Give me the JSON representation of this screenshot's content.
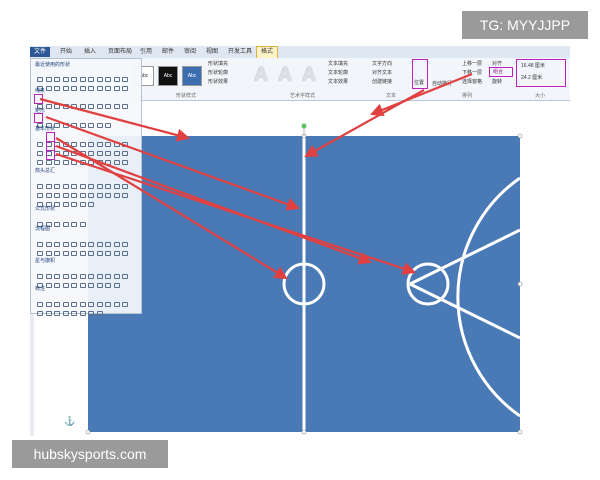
{
  "ribbon": {
    "tabs": [
      {
        "label": "文件"
      },
      {
        "label": "开始"
      },
      {
        "label": "插入"
      },
      {
        "label": "页面布局"
      },
      {
        "label": "引用"
      },
      {
        "label": "邮件"
      },
      {
        "label": "审阅"
      },
      {
        "label": "视图"
      },
      {
        "label": "开发工具"
      },
      {
        "label": "格式"
      }
    ],
    "style_swatches": [
      {
        "label": "Abc"
      },
      {
        "label": "Abc"
      },
      {
        "label": "Abc"
      }
    ],
    "shape_fill": "形状填充",
    "shape_outline": "形状轮廓",
    "shape_effect": "形状效果",
    "group_shape_style": "形状样式",
    "group_wordart": "艺术字样式",
    "text_fill": "文本填充",
    "text_outline": "文本轮廓",
    "text_effect": "文本效果",
    "text_direction": "文字方向",
    "align_text": "对齐文本",
    "create_link": "创建链接",
    "group_text": "文本",
    "position": "位置",
    "auto_wrap": "自动换行",
    "bring_forward": "上移一层",
    "send_backward": "下移一层",
    "selection_pane": "选择窗格",
    "align": "对齐",
    "group": "组合",
    "rotate": "旋转",
    "group_arrange": "排列",
    "height": "16.48 厘米",
    "width": "24.2 厘米",
    "group_size": "大小"
  },
  "shape_panel": {
    "sections": [
      "最近使用的形状",
      "线条",
      "矩形",
      "基本形状",
      "箭头总汇",
      "公式形状",
      "流程图",
      "星与旗帜",
      "标注"
    ]
  },
  "watermarks": {
    "tg": "TG: MYYJJPP",
    "site": "hubskysports.com"
  },
  "colors": {
    "court": "#4a7ab6",
    "lines": "#ffffff",
    "arrows": "#e04040",
    "highlight": "#c020c0"
  }
}
